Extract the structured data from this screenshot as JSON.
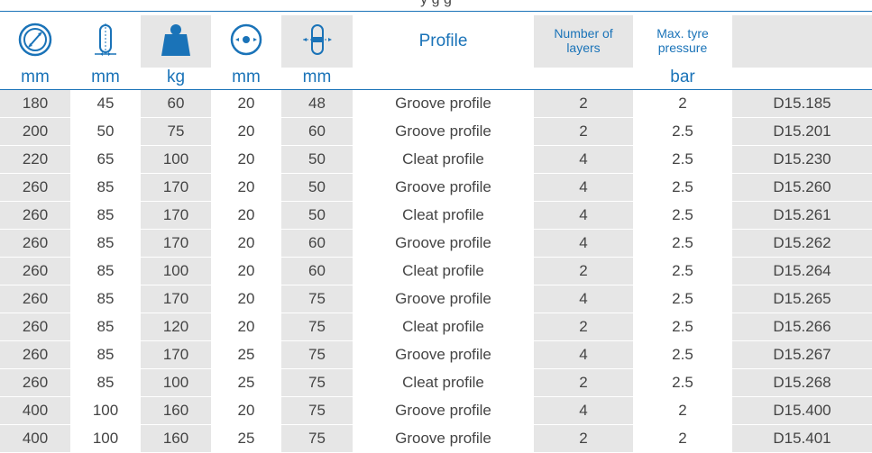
{
  "header": {
    "title": "y        g        g",
    "profile_label": "Profile",
    "layers_label": "Number of layers",
    "pressure_label": "Max. tyre pressure",
    "units": [
      "mm",
      "mm",
      "kg",
      "mm",
      "mm",
      "",
      "",
      "bar",
      ""
    ]
  },
  "icons": [
    "wheel-diameter-icon",
    "wheel-width-icon",
    "load-weight-icon",
    "bore-diameter-icon",
    "hub-length-icon"
  ],
  "colors": {
    "accent": "#1a73b8",
    "shade": "#e6e6e6",
    "text": "#444444"
  },
  "rows": [
    [
      "180",
      "45",
      "60",
      "20",
      "48",
      "Groove profile",
      "2",
      "2",
      "D15.185"
    ],
    [
      "200",
      "50",
      "75",
      "20",
      "60",
      "Groove profile",
      "2",
      "2.5",
      "D15.201"
    ],
    [
      "220",
      "65",
      "100",
      "20",
      "50",
      "Cleat profile",
      "4",
      "2.5",
      "D15.230"
    ],
    [
      "260",
      "85",
      "170",
      "20",
      "50",
      "Groove profile",
      "4",
      "2.5",
      "D15.260"
    ],
    [
      "260",
      "85",
      "170",
      "20",
      "50",
      "Cleat profile",
      "4",
      "2.5",
      "D15.261"
    ],
    [
      "260",
      "85",
      "170",
      "20",
      "60",
      "Groove profile",
      "4",
      "2.5",
      "D15.262"
    ],
    [
      "260",
      "85",
      "100",
      "20",
      "60",
      "Cleat profile",
      "2",
      "2.5",
      "D15.264"
    ],
    [
      "260",
      "85",
      "170",
      "20",
      "75",
      "Groove profile",
      "4",
      "2.5",
      "D15.265"
    ],
    [
      "260",
      "85",
      "120",
      "20",
      "75",
      "Cleat profile",
      "2",
      "2.5",
      "D15.266"
    ],
    [
      "260",
      "85",
      "170",
      "25",
      "75",
      "Groove profile",
      "4",
      "2.5",
      "D15.267"
    ],
    [
      "260",
      "85",
      "100",
      "25",
      "75",
      "Cleat profile",
      "2",
      "2.5",
      "D15.268"
    ],
    [
      "400",
      "100",
      "160",
      "20",
      "75",
      "Groove profile",
      "4",
      "2",
      "D15.400"
    ],
    [
      "400",
      "100",
      "160",
      "25",
      "75",
      "Groove profile",
      "2",
      "2",
      "D15.401"
    ]
  ]
}
